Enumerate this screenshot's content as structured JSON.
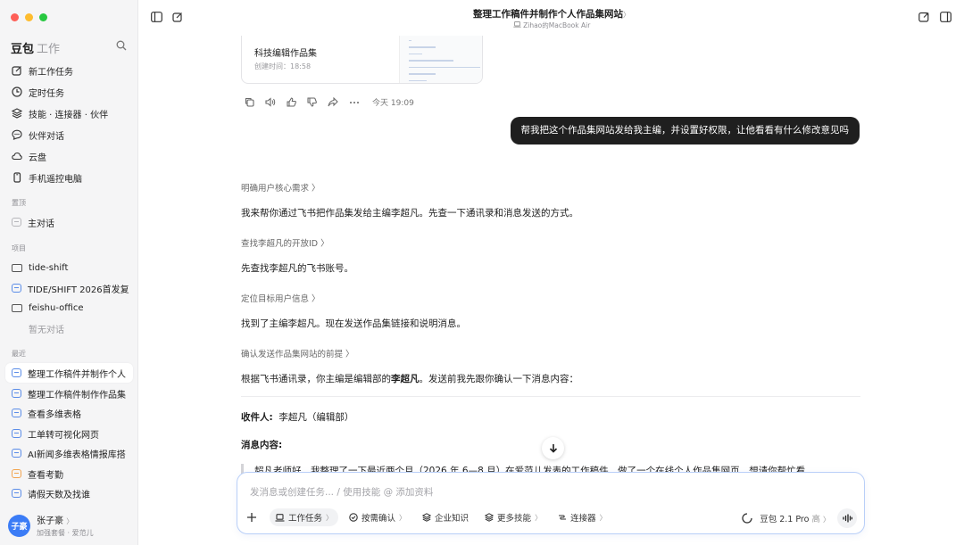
{
  "app": {
    "brand": "豆包",
    "brand_sub": "工作"
  },
  "sidebar": {
    "nav": [
      {
        "label": "新工作任务",
        "icon": "edit-icon"
      },
      {
        "label": "定时任务",
        "icon": "clock-icon"
      },
      {
        "label": "技能 · 连接器 · 伙伴",
        "icon": "layers-icon"
      },
      {
        "label": "伙伴对话",
        "icon": "chat-bubble-icon"
      },
      {
        "label": "云盘",
        "icon": "cloud-icon"
      },
      {
        "label": "手机遥控电脑",
        "icon": "phone-icon"
      }
    ],
    "pinned_title": "置顶",
    "pinned": [
      {
        "label": "主对话"
      }
    ],
    "projects_title": "项目",
    "projects": [
      {
        "label": "tide-shift"
      },
      {
        "label": "TIDE/SHIFT 2026首发复"
      },
      {
        "label": "feishu-office"
      }
    ],
    "no_chats": "暂无对话",
    "recent_title": "最近",
    "recent": [
      {
        "label": "整理工作稿件并制作个人"
      },
      {
        "label": "整理工作稿件制作作品集"
      },
      {
        "label": "查看多维表格"
      },
      {
        "label": "工单转可视化网页"
      },
      {
        "label": "AI新闻多维表格情报库搭"
      },
      {
        "label": "查看考勤"
      },
      {
        "label": "请假天数及找谁"
      }
    ],
    "user": {
      "avatar": "子豪",
      "name": "张子豪",
      "chevron": "〉",
      "plan": "加强套餐 · 爱范儿"
    }
  },
  "header": {
    "title": "整理工作稿件并制作个人作品集网站",
    "title_chevron": "〉",
    "device": "Zihao的MacBook Air"
  },
  "conversation": {
    "card": {
      "title": "科技编辑作品集",
      "time": "创建时间：18:58"
    },
    "timestamp": "今天 19:09",
    "user_message": "帮我把这个作品集网站发给我主编，并设置好权限，让他看看有什么修改意见吗",
    "steps": [
      {
        "label": "明确用户核心需求",
        "text": "我来帮你通过飞书把作品集发给主编李超凡。先查一下通讯录和消息发送的方式。"
      },
      {
        "label": "查找李超凡的开放ID",
        "text": "先查找李超凡的飞书账号。"
      },
      {
        "label": "定位目标用户信息",
        "text": "找到了主编李超凡。现在发送作品集链接和说明消息。"
      },
      {
        "label": "确认发送作品集网站的前提",
        "text_before": "根据飞书通讯录，你主编是编辑部的",
        "text_bold": "李超凡",
        "text_after": "。发送前我先跟你确认一下消息内容："
      }
    ],
    "step_chevron": "〉",
    "recipient_label": "收件人:",
    "recipient_value": "李超凡（编辑部）",
    "content_label": "消息内容:",
    "message_preview": "超凡老师好，我整理了一下最近两个月（2026 年 6—8 月）在爱范儿发表的工作稿件，做了一个在线个人作品集网页，想请你帮忙看"
  },
  "composer": {
    "placeholder": "发消息或创建任务... / 使用技能 @ 添加资料",
    "chips": [
      {
        "label": "工作任务",
        "icon": "laptop-icon",
        "caret": "〉"
      },
      {
        "label": "按需确认",
        "icon": "check-circle-icon",
        "caret": "〉"
      },
      {
        "label": "企业知识",
        "icon": "stack-icon",
        "caret": ""
      },
      {
        "label": "更多技能",
        "icon": "stack-icon",
        "caret": "〉"
      },
      {
        "label": "连接器",
        "icon": "connector-icon",
        "caret": "〉"
      }
    ],
    "model": "豆包 2.1 Pro",
    "model_level": "高",
    "model_caret": "〉"
  },
  "colors": {
    "accent": "#3b7cf6",
    "bubble": "#1f1f1f",
    "composer_border": "#b9cff8"
  }
}
